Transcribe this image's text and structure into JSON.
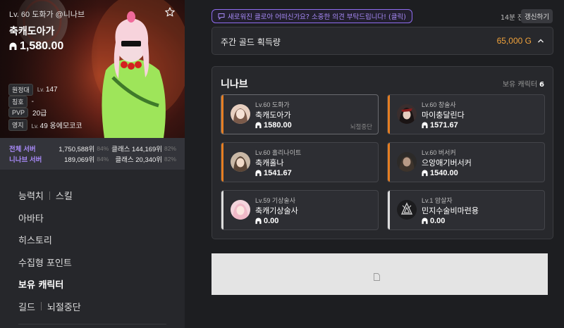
{
  "profile": {
    "subtitle": "Lv. 60 도화가 @니나브",
    "name": "축캐도아가",
    "item_level": "1,580.00",
    "info": [
      {
        "tag": "원정대",
        "lv": "Lv.",
        "value": "147"
      },
      {
        "tag": "칭호",
        "lv": "",
        "value": "-"
      },
      {
        "tag": "PVP",
        "lv": "",
        "value": "20급"
      },
      {
        "tag": "영지",
        "lv": "Lv.",
        "value": "49 옹에모코코"
      }
    ],
    "ranks": [
      {
        "label": "전체 서버",
        "rank": "1,750,588위",
        "pct": "84%",
        "class_rank": "클래스 144,169위",
        "class_pct": "82%"
      },
      {
        "label": "니나브 서버",
        "rank": "189,069위",
        "pct": "84%",
        "class_rank": "클래스 20,340위",
        "class_pct": "82%"
      }
    ]
  },
  "menu": {
    "stats": "능력치",
    "skills": "스킬",
    "avatar": "아바타",
    "history": "히스토리",
    "collectibles": "수집형 포인트",
    "characters": "보유 캐릭터",
    "guild": "길드",
    "guild_status": "뇌절중단"
  },
  "banner": {
    "text": "새로워진 클로아 어떠신가요? 소중한 의견 부탁드립니다! (클릭)"
  },
  "header": {
    "time_ago": "14분 전",
    "refresh_label": "갱신하기"
  },
  "gold": {
    "title": "주간 골드 획득량",
    "value": "65,000 G"
  },
  "roster": {
    "server": "니나브",
    "count_label": "보유 캐릭터",
    "count": "6",
    "characters": [
      {
        "cls": "Lv.60 도화가",
        "name": "축캐도아가",
        "ilvl": "1580.00",
        "note": "뇌절중단",
        "stripe": "#e67e22"
      },
      {
        "cls": "Lv.60 창술사",
        "name": "마이충달린다",
        "ilvl": "1571.67",
        "note": "",
        "stripe": "#e67e22"
      },
      {
        "cls": "Lv.60 홀리나이트",
        "name": "축캐홀나",
        "ilvl": "1541.67",
        "note": "",
        "stripe": "#e67e22"
      },
      {
        "cls": "Lv.60 버서커",
        "name": "으앙애기버서커",
        "ilvl": "1540.00",
        "note": "",
        "stripe": "#e67e22"
      },
      {
        "cls": "Lv.59 기상술사",
        "name": "축캐기상술사",
        "ilvl": "0.00",
        "note": "",
        "stripe": "#dcdcdc"
      },
      {
        "cls": "Lv.1 암살자",
        "name": "민지수술비마련용",
        "ilvl": "0.00",
        "note": "",
        "stripe": "#dcdcdc"
      }
    ]
  },
  "colors": {
    "accent_purple": "#a88af8",
    "gold": "#f0a23b",
    "stripe_orange": "#e67e22"
  }
}
